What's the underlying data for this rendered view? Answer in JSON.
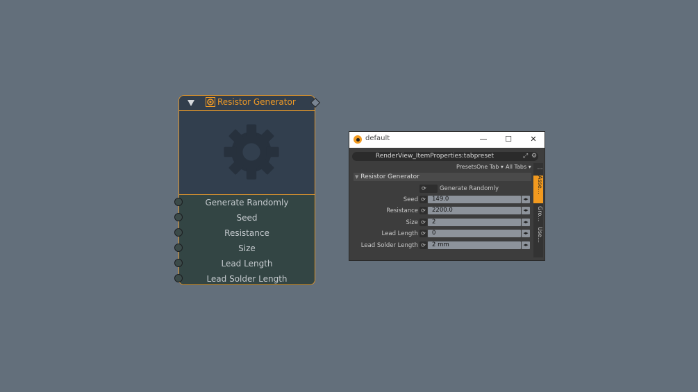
{
  "node": {
    "title": "Resistor Generator",
    "ports": [
      "Generate Randomly",
      "Seed",
      "Resistance",
      "Size",
      "Lead Length",
      "Lead Solder Length"
    ],
    "accent_color": "#e0962c",
    "title_color": "#ef9a26"
  },
  "window": {
    "title": "default",
    "minimize_label": "—",
    "maximize_label": "☐",
    "close_label": "✕",
    "tab_preset": "RenderView_ItemProperties:tabpreset",
    "presets_label": "Presets",
    "one_tab_label": "One Tab ▾",
    "all_tabs_label": "All Tabs ▾",
    "section_title": "Resistor Generator",
    "checkbox_label": "Generate Randomly",
    "fields": [
      {
        "label": "Seed",
        "value": "149.0"
      },
      {
        "label": "Resistance",
        "value": "2200.0"
      },
      {
        "label": "Size",
        "value": "2"
      },
      {
        "label": "Lead Length",
        "value": "0"
      },
      {
        "label": "Lead Solder Length",
        "value": "2 mm"
      }
    ],
    "side_tabs": [
      "Asse…",
      "Gro…",
      "Use…"
    ],
    "more_label": "⋮"
  }
}
